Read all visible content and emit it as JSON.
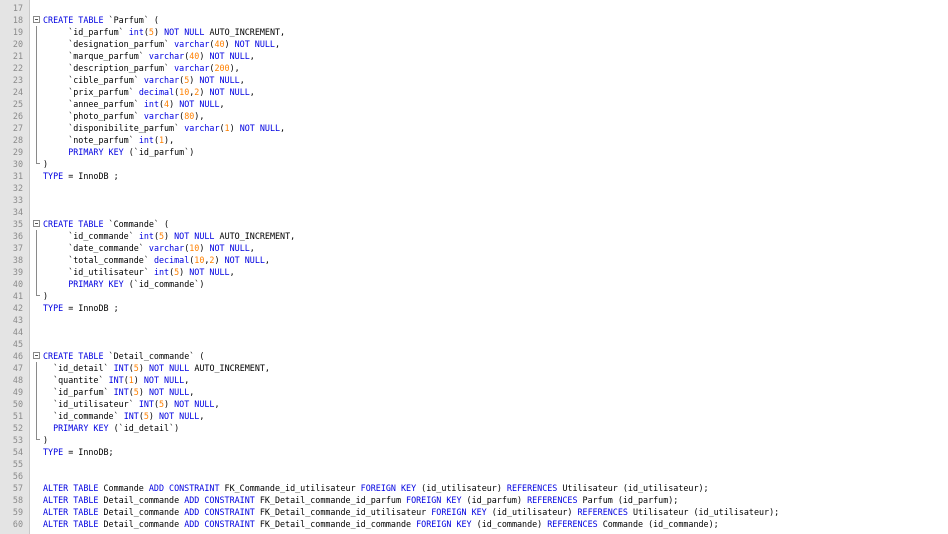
{
  "colors": {
    "keyword": "#0000e0",
    "number": "#ff8000",
    "text": "#000000",
    "line_number": "#8a8a8a"
  },
  "lines": [
    {
      "n": "17",
      "fold": "",
      "indent": "",
      "segs": []
    },
    {
      "n": "18",
      "fold": "start",
      "indent": "",
      "segs": [
        [
          "k",
          "CREATE TABLE"
        ],
        [
          "t",
          " `Parfum` ("
        ]
      ]
    },
    {
      "n": "19",
      "fold": "line",
      "indent": "     ",
      "segs": [
        [
          "t",
          "`id_parfum` "
        ],
        [
          "k",
          "int"
        ],
        [
          "t",
          "("
        ],
        [
          "n",
          "5"
        ],
        [
          "t",
          ") "
        ],
        [
          "k",
          "NOT NULL"
        ],
        [
          "t",
          " AUTO_INCREMENT,"
        ]
      ]
    },
    {
      "n": "20",
      "fold": "line",
      "indent": "     ",
      "segs": [
        [
          "t",
          "`designation_parfum` "
        ],
        [
          "k",
          "varchar"
        ],
        [
          "t",
          "("
        ],
        [
          "n",
          "40"
        ],
        [
          "t",
          ") "
        ],
        [
          "k",
          "NOT NULL"
        ],
        [
          "t",
          ","
        ]
      ]
    },
    {
      "n": "21",
      "fold": "line",
      "indent": "     ",
      "segs": [
        [
          "t",
          "`marque_parfum` "
        ],
        [
          "k",
          "varchar"
        ],
        [
          "t",
          "("
        ],
        [
          "n",
          "40"
        ],
        [
          "t",
          ") "
        ],
        [
          "k",
          "NOT NULL"
        ],
        [
          "t",
          ","
        ]
      ]
    },
    {
      "n": "22",
      "fold": "line",
      "indent": "     ",
      "segs": [
        [
          "t",
          "`description_parfum` "
        ],
        [
          "k",
          "varchar"
        ],
        [
          "t",
          "("
        ],
        [
          "n",
          "200"
        ],
        [
          "t",
          "),"
        ]
      ]
    },
    {
      "n": "23",
      "fold": "line",
      "indent": "     ",
      "segs": [
        [
          "t",
          "`cible_parfum` "
        ],
        [
          "k",
          "varchar"
        ],
        [
          "t",
          "("
        ],
        [
          "n",
          "5"
        ],
        [
          "t",
          ") "
        ],
        [
          "k",
          "NOT NULL"
        ],
        [
          "t",
          ","
        ]
      ]
    },
    {
      "n": "24",
      "fold": "line",
      "indent": "     ",
      "segs": [
        [
          "t",
          "`prix_parfum` "
        ],
        [
          "k",
          "decimal"
        ],
        [
          "t",
          "("
        ],
        [
          "n",
          "10"
        ],
        [
          "t",
          ","
        ],
        [
          "n",
          "2"
        ],
        [
          "t",
          ") "
        ],
        [
          "k",
          "NOT NULL"
        ],
        [
          "t",
          ","
        ]
      ]
    },
    {
      "n": "25",
      "fold": "line",
      "indent": "     ",
      "segs": [
        [
          "t",
          "`annee_parfum` "
        ],
        [
          "k",
          "int"
        ],
        [
          "t",
          "("
        ],
        [
          "n",
          "4"
        ],
        [
          "t",
          ") "
        ],
        [
          "k",
          "NOT NULL"
        ],
        [
          "t",
          ","
        ]
      ]
    },
    {
      "n": "26",
      "fold": "line",
      "indent": "     ",
      "segs": [
        [
          "t",
          "`photo_parfum` "
        ],
        [
          "k",
          "varchar"
        ],
        [
          "t",
          "("
        ],
        [
          "n",
          "80"
        ],
        [
          "t",
          "),"
        ]
      ]
    },
    {
      "n": "27",
      "fold": "line",
      "indent": "     ",
      "segs": [
        [
          "t",
          "`disponibilite_parfum` "
        ],
        [
          "k",
          "varchar"
        ],
        [
          "t",
          "("
        ],
        [
          "n",
          "1"
        ],
        [
          "t",
          ") "
        ],
        [
          "k",
          "NOT NULL"
        ],
        [
          "t",
          ","
        ]
      ]
    },
    {
      "n": "28",
      "fold": "line",
      "indent": "     ",
      "segs": [
        [
          "t",
          "`note_parfum` "
        ],
        [
          "k",
          "int"
        ],
        [
          "t",
          "("
        ],
        [
          "n",
          "1"
        ],
        [
          "t",
          "),"
        ]
      ]
    },
    {
      "n": "29",
      "fold": "line",
      "indent": "     ",
      "segs": [
        [
          "k",
          "PRIMARY KEY"
        ],
        [
          "t",
          " (`id_parfum`)"
        ]
      ]
    },
    {
      "n": "30",
      "fold": "end",
      "indent": "",
      "segs": [
        [
          "t",
          ")"
        ]
      ]
    },
    {
      "n": "31",
      "fold": "",
      "indent": "",
      "segs": [
        [
          "k",
          "TYPE"
        ],
        [
          "t",
          " = InnoDB ;"
        ]
      ]
    },
    {
      "n": "32",
      "fold": "",
      "indent": "",
      "segs": []
    },
    {
      "n": "33",
      "fold": "",
      "indent": "",
      "segs": []
    },
    {
      "n": "34",
      "fold": "",
      "indent": "",
      "segs": []
    },
    {
      "n": "35",
      "fold": "start",
      "indent": "",
      "segs": [
        [
          "k",
          "CREATE TABLE"
        ],
        [
          "t",
          " `Commande` ("
        ]
      ]
    },
    {
      "n": "36",
      "fold": "line",
      "indent": "     ",
      "segs": [
        [
          "t",
          "`id_commande` "
        ],
        [
          "k",
          "int"
        ],
        [
          "t",
          "("
        ],
        [
          "n",
          "5"
        ],
        [
          "t",
          ") "
        ],
        [
          "k",
          "NOT NULL"
        ],
        [
          "t",
          " AUTO_INCREMENT,"
        ]
      ]
    },
    {
      "n": "37",
      "fold": "line",
      "indent": "     ",
      "segs": [
        [
          "t",
          "`date_commande` "
        ],
        [
          "k",
          "varchar"
        ],
        [
          "t",
          "("
        ],
        [
          "n",
          "10"
        ],
        [
          "t",
          ") "
        ],
        [
          "k",
          "NOT NULL"
        ],
        [
          "t",
          ","
        ]
      ]
    },
    {
      "n": "38",
      "fold": "line",
      "indent": "     ",
      "segs": [
        [
          "t",
          "`total_commande` "
        ],
        [
          "k",
          "decimal"
        ],
        [
          "t",
          "("
        ],
        [
          "n",
          "10"
        ],
        [
          "t",
          ","
        ],
        [
          "n",
          "2"
        ],
        [
          "t",
          ") "
        ],
        [
          "k",
          "NOT NULL"
        ],
        [
          "t",
          ","
        ]
      ]
    },
    {
      "n": "39",
      "fold": "line",
      "indent": "     ",
      "segs": [
        [
          "t",
          "`id_utilisateur` "
        ],
        [
          "k",
          "int"
        ],
        [
          "t",
          "("
        ],
        [
          "n",
          "5"
        ],
        [
          "t",
          ") "
        ],
        [
          "k",
          "NOT NULL"
        ],
        [
          "t",
          ","
        ]
      ]
    },
    {
      "n": "40",
      "fold": "line",
      "indent": "     ",
      "segs": [
        [
          "k",
          "PRIMARY KEY"
        ],
        [
          "t",
          " (`id_commande`)"
        ]
      ]
    },
    {
      "n": "41",
      "fold": "end",
      "indent": "",
      "segs": [
        [
          "t",
          ")"
        ]
      ]
    },
    {
      "n": "42",
      "fold": "",
      "indent": "",
      "segs": [
        [
          "k",
          "TYPE"
        ],
        [
          "t",
          " = InnoDB ;"
        ]
      ]
    },
    {
      "n": "43",
      "fold": "",
      "indent": "",
      "segs": []
    },
    {
      "n": "44",
      "fold": "",
      "indent": "",
      "segs": []
    },
    {
      "n": "45",
      "fold": "",
      "indent": "",
      "segs": []
    },
    {
      "n": "46",
      "fold": "start",
      "indent": "",
      "segs": [
        [
          "k",
          "CREATE TABLE"
        ],
        [
          "t",
          " `Detail_commande` ("
        ]
      ]
    },
    {
      "n": "47",
      "fold": "line",
      "indent": "  ",
      "segs": [
        [
          "t",
          "`id_detail` "
        ],
        [
          "k",
          "INT"
        ],
        [
          "t",
          "("
        ],
        [
          "n",
          "5"
        ],
        [
          "t",
          ") "
        ],
        [
          "k",
          "NOT NULL"
        ],
        [
          "t",
          " AUTO_INCREMENT,"
        ]
      ]
    },
    {
      "n": "48",
      "fold": "line",
      "indent": "  ",
      "segs": [
        [
          "t",
          "`quantite` "
        ],
        [
          "k",
          "INT"
        ],
        [
          "t",
          "("
        ],
        [
          "n",
          "1"
        ],
        [
          "t",
          ") "
        ],
        [
          "k",
          "NOT NULL"
        ],
        [
          "t",
          ","
        ]
      ]
    },
    {
      "n": "49",
      "fold": "line",
      "indent": "  ",
      "segs": [
        [
          "t",
          "`id_parfum` "
        ],
        [
          "k",
          "INT"
        ],
        [
          "t",
          "("
        ],
        [
          "n",
          "5"
        ],
        [
          "t",
          ") "
        ],
        [
          "k",
          "NOT NULL"
        ],
        [
          "t",
          ","
        ]
      ]
    },
    {
      "n": "50",
      "fold": "line",
      "indent": "  ",
      "segs": [
        [
          "t",
          "`id_utilisateur` "
        ],
        [
          "k",
          "INT"
        ],
        [
          "t",
          "("
        ],
        [
          "n",
          "5"
        ],
        [
          "t",
          ") "
        ],
        [
          "k",
          "NOT NULL"
        ],
        [
          "t",
          ","
        ]
      ]
    },
    {
      "n": "51",
      "fold": "line",
      "indent": "  ",
      "segs": [
        [
          "t",
          "`id_commande` "
        ],
        [
          "k",
          "INT"
        ],
        [
          "t",
          "("
        ],
        [
          "n",
          "5"
        ],
        [
          "t",
          ") "
        ],
        [
          "k",
          "NOT NULL"
        ],
        [
          "t",
          ","
        ]
      ]
    },
    {
      "n": "52",
      "fold": "line",
      "indent": "  ",
      "segs": [
        [
          "k",
          "PRIMARY KEY"
        ],
        [
          "t",
          " (`id_detail`)"
        ]
      ]
    },
    {
      "n": "53",
      "fold": "end",
      "indent": "",
      "segs": [
        [
          "t",
          ")"
        ]
      ]
    },
    {
      "n": "54",
      "fold": "",
      "indent": "",
      "segs": [
        [
          "k",
          "TYPE"
        ],
        [
          "t",
          " = InnoDB;"
        ]
      ]
    },
    {
      "n": "55",
      "fold": "",
      "indent": "",
      "segs": []
    },
    {
      "n": "56",
      "fold": "",
      "indent": "",
      "segs": []
    },
    {
      "n": "57",
      "fold": "",
      "indent": "",
      "segs": [
        [
          "k",
          "ALTER TABLE"
        ],
        [
          "t",
          " Commande "
        ],
        [
          "k",
          "ADD CONSTRAINT"
        ],
        [
          "t",
          " FK_Commande_id_utilisateur "
        ],
        [
          "k",
          "FOREIGN KEY"
        ],
        [
          "t",
          " (id_utilisateur) "
        ],
        [
          "k",
          "REFERENCES"
        ],
        [
          "t",
          " Utilisateur (id_utilisateur);"
        ]
      ]
    },
    {
      "n": "58",
      "fold": "",
      "indent": "",
      "segs": [
        [
          "k",
          "ALTER TABLE"
        ],
        [
          "t",
          " Detail_commande "
        ],
        [
          "k",
          "ADD CONSTRAINT"
        ],
        [
          "t",
          " FK_Detail_commande_id_parfum "
        ],
        [
          "k",
          "FOREIGN KEY"
        ],
        [
          "t",
          " (id_parfum) "
        ],
        [
          "k",
          "REFERENCES"
        ],
        [
          "t",
          " Parfum (id_parfum);"
        ]
      ]
    },
    {
      "n": "59",
      "fold": "",
      "indent": "",
      "segs": [
        [
          "k",
          "ALTER TABLE"
        ],
        [
          "t",
          " Detail_commande "
        ],
        [
          "k",
          "ADD CONSTRAINT"
        ],
        [
          "t",
          " FK_Detail_commande_id_utilisateur "
        ],
        [
          "k",
          "FOREIGN KEY"
        ],
        [
          "t",
          " (id_utilisateur) "
        ],
        [
          "k",
          "REFERENCES"
        ],
        [
          "t",
          " Utilisateur (id_utilisateur);"
        ]
      ]
    },
    {
      "n": "60",
      "fold": "",
      "indent": "",
      "segs": [
        [
          "k",
          "ALTER TABLE"
        ],
        [
          "t",
          " Detail_commande "
        ],
        [
          "k",
          "ADD CONSTRAINT"
        ],
        [
          "t",
          " FK_Detail_commande_id_commande "
        ],
        [
          "k",
          "FOREIGN KEY"
        ],
        [
          "t",
          " (id_commande) "
        ],
        [
          "k",
          "REFERENCES"
        ],
        [
          "t",
          " Commande (id_commande);"
        ]
      ]
    }
  ]
}
